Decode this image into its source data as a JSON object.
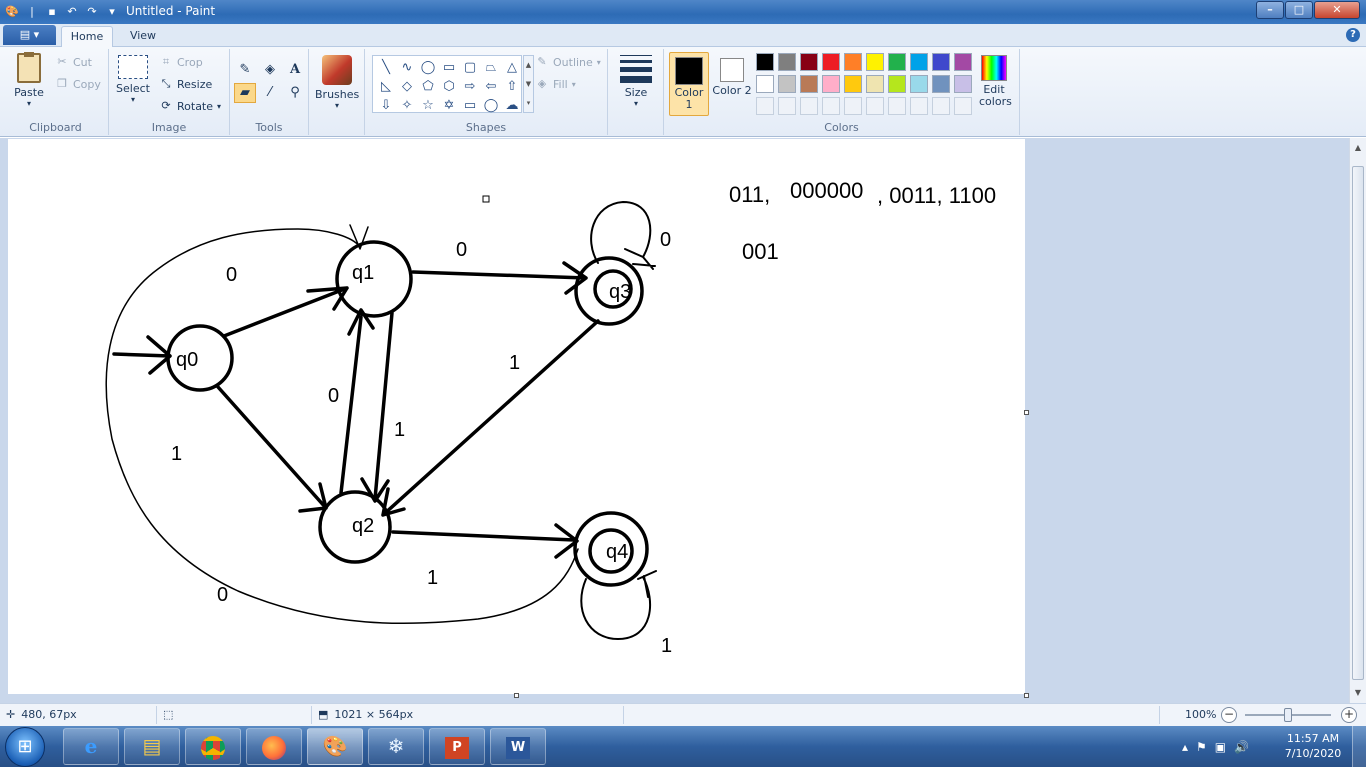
{
  "window": {
    "title": "Untitled - Paint",
    "buttons": {
      "minimize": "–",
      "maximize": "□",
      "close": "✕"
    }
  },
  "ribbon": {
    "app_menu": "▤ ▾",
    "tabs": [
      {
        "label": "Home",
        "active": true
      },
      {
        "label": "View",
        "active": false
      }
    ],
    "help": "?",
    "clipboard": {
      "paste": "Paste",
      "cut": "Cut",
      "copy": "Copy",
      "group": "Clipboard"
    },
    "image": {
      "select": "Select",
      "crop": "Crop",
      "resize": "Resize",
      "rotate": "Rotate",
      "group": "Image"
    },
    "tools": {
      "group": "Tools",
      "icons": [
        "pencil-icon",
        "fill-bucket-icon",
        "text-icon",
        "eraser-icon",
        "color-picker-icon",
        "magnifier-icon"
      ]
    },
    "brushes": {
      "label": "Brushes"
    },
    "shapes": {
      "outline": "Outline",
      "fill": "Fill",
      "group": "Shapes"
    },
    "size": {
      "label": "Size"
    },
    "colors": {
      "color1": "Color 1",
      "color2": "Color 2",
      "edit": "Edit colors",
      "group": "Colors",
      "color1_value": "#000000",
      "color2_value": "#ffffff",
      "palette_row1": [
        "#000000",
        "#7f7f7f",
        "#880015",
        "#ed1c24",
        "#ff7f27",
        "#fff200",
        "#22b14c",
        "#00a2e8",
        "#3f48cc",
        "#a349a4"
      ],
      "palette_row2": [
        "#ffffff",
        "#c3c3c3",
        "#b97a57",
        "#ffaec9",
        "#ffc90e",
        "#efe4b0",
        "#b5e61d",
        "#99d9ea",
        "#7092be",
        "#c8bfe7"
      ]
    }
  },
  "canvas_text": {
    "strings": [
      "011,",
      "000000",
      ", 0011, 1100",
      "001"
    ],
    "states": [
      "q0",
      "q1",
      "q2",
      "q3",
      "q4"
    ],
    "edge_labels": {
      "q0_q1": "0",
      "q1_q3": "0",
      "q3_self": "0",
      "q3_q2": "1",
      "q1_q2_a": "0",
      "q1_q2_b": "1",
      "q0_q2": "1",
      "q2_q4": "1",
      "loop_q4_q1": "0",
      "q4_self": "1"
    }
  },
  "status": {
    "cursor_pos": "480, 67px",
    "canvas_size": "1021 × 564px",
    "zoom": "100%",
    "zoom_fraction": 0.5
  },
  "taskbar": {
    "apps": [
      "ie-icon",
      "explorer-icon",
      "chrome-icon",
      "firefox-icon",
      "paint-icon",
      "snowflake-icon",
      "powerpoint-icon",
      "word-icon"
    ],
    "active_app": "paint-icon",
    "time": "11:57 AM",
    "date": "7/10/2020"
  }
}
